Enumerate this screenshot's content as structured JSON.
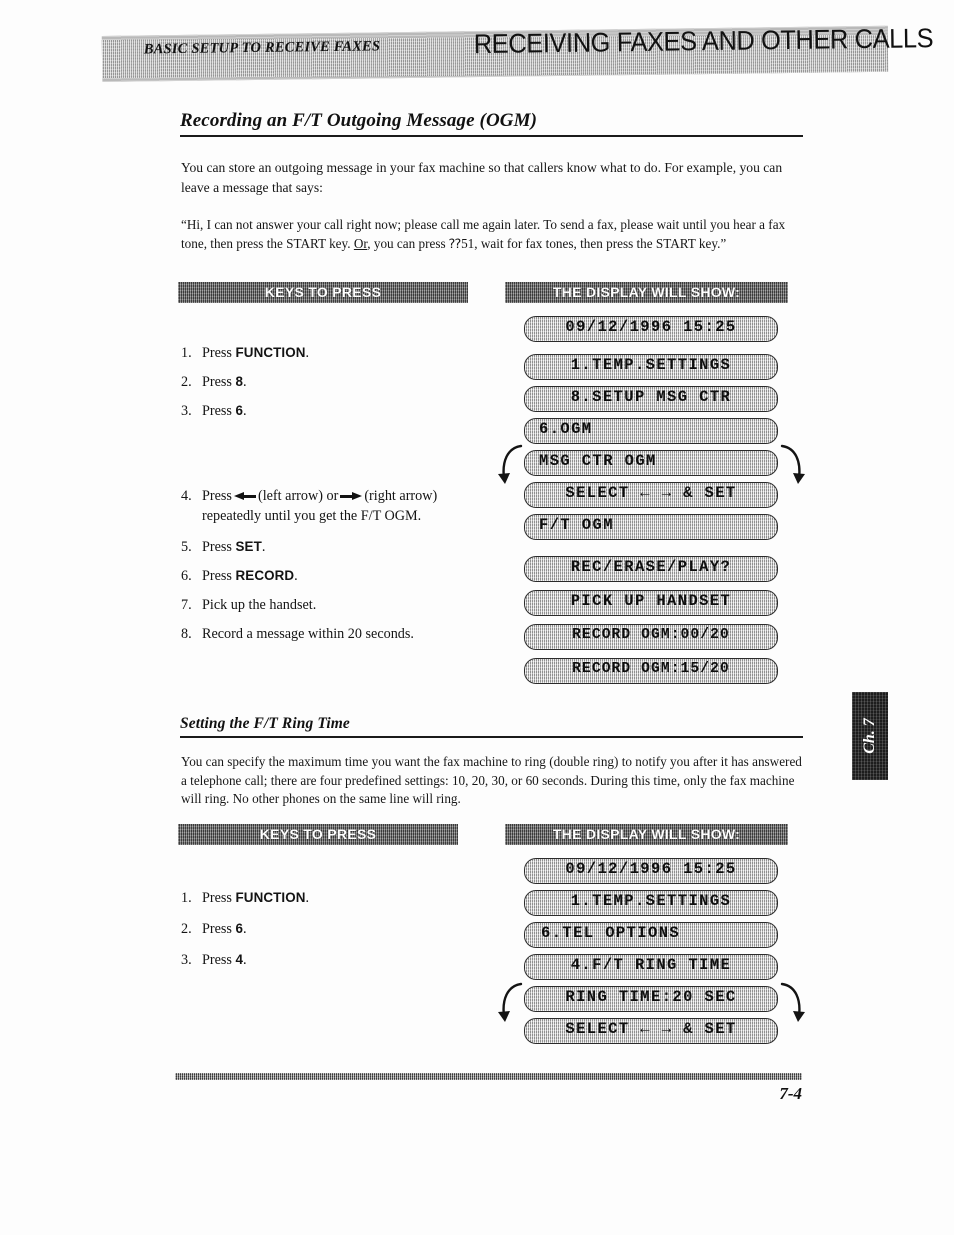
{
  "header": {
    "running_head": "BASIC SETUP TO RECEIVE FAXES",
    "chapter_title": "RECEIVING FAXES AND OTHER CALLS"
  },
  "section_ogm": {
    "heading": "Recording an F/T Outgoing Message (OGM)",
    "intro": "You can store an outgoing message in your fax machine so that callers know what to do. For example, you can leave a message that says:",
    "quote_line1": "“Hi, I can not answer your call right now; please call me again later. To send a fax, please wait",
    "quote_line2_a": "until you hear a fax tone, then press the START key. ",
    "quote_line2_b": "Or",
    "quote_line2_c": ", you can press ⁇51, wait for fax tones,",
    "quote_line3": "then press the START key.”",
    "keys_banner": "KEYS TO PRESS",
    "display_banner": "THE DISPLAY WILL SHOW:",
    "steps": [
      {
        "num": "1.",
        "prefix": "Press ",
        "key": "FUNCTION",
        "suffix": "."
      },
      {
        "num": "2.",
        "prefix": "Press ",
        "key": "8",
        "suffix": "."
      },
      {
        "num": "3.",
        "prefix": "Press ",
        "key": "6",
        "suffix": "."
      },
      {
        "num": "4.",
        "prefix": "Press ",
        "key": "",
        "suffix": ""
      },
      {
        "num": "5.",
        "prefix": "Press ",
        "key": "SET",
        "suffix": "."
      },
      {
        "num": "6.",
        "prefix": "Press ",
        "key": "RECORD",
        "suffix": "."
      },
      {
        "num": "7.",
        "prefix": "Pick up the handset.",
        "key": "",
        "suffix": ""
      },
      {
        "num": "8.",
        "prefix": "Record a message within 20 seconds.",
        "key": "",
        "suffix": ""
      }
    ],
    "step4_text_a": "Press",
    "step4_text_b": "(left arrow) or",
    "step4_text_c": "(right arrow) repeatedly until you get the F/T OGM.",
    "displays_group1": [
      "09/12/1996 15:25",
      "1.TEMP.SETTINGS",
      "8.SETUP MSG CTR",
      "6.OGM",
      "MSG CTR OGM",
      "SELECT ← → & SET",
      "F/T OGM"
    ],
    "displays_group2": [
      "REC/ERASE/PLAY?",
      "PICK UP HANDSET",
      "RECORD OGM:00/20",
      "RECORD OGM:15/20"
    ]
  },
  "section_ring": {
    "heading": "Setting the F/T Ring Time",
    "para_line1": "You can specify the maximum time you want the fax machine to ring (double ring) to notify you",
    "para_line2": "after it has answered a telephone call; there are four predefined settings: 10, 20, 30, or 60 seconds.",
    "para_line3": "During this time, only the fax machine will ring. No other phones on the same line will ring.",
    "keys_banner": "KEYS TO PRESS",
    "display_banner": "THE DISPLAY WILL SHOW:",
    "steps": [
      {
        "num": "1.",
        "prefix": "Press ",
        "key": "FUNCTION",
        "suffix": "."
      },
      {
        "num": "2.",
        "prefix": "Press ",
        "key": "6",
        "suffix": "."
      },
      {
        "num": "3.",
        "prefix": "Press ",
        "key": "4",
        "suffix": "."
      }
    ],
    "displays": [
      "09/12/1996 15:25",
      "1.TEMP.SETTINGS",
      "6.TEL OPTIONS",
      "4.F/T RING TIME",
      "RING TIME:20 SEC",
      "SELECT ← → & SET"
    ]
  },
  "chapter_tab": {
    "label": "Ch. 7"
  },
  "footer": {
    "page_number": "7-4"
  }
}
